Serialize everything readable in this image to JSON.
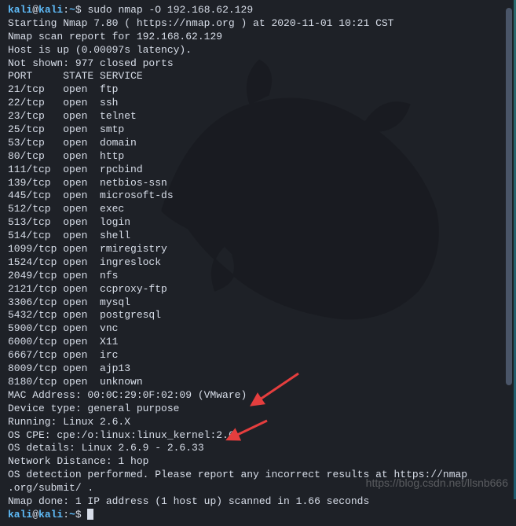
{
  "prompt1": {
    "user": "kali",
    "at": "@",
    "host": "kali",
    "colon": ":",
    "path": "~",
    "dollar": "$ ",
    "command": "sudo nmap -O 192.168.62.129"
  },
  "output": {
    "l01": "Starting Nmap 7.80 ( https://nmap.org ) at 2020-11-01 10:21 CST",
    "l02": "Nmap scan report for 192.168.62.129",
    "l03": "Host is up (0.00097s latency).",
    "l04": "Not shown: 977 closed ports",
    "l05": "PORT     STATE SERVICE",
    "l06": "21/tcp   open  ftp",
    "l07": "22/tcp   open  ssh",
    "l08": "23/tcp   open  telnet",
    "l09": "25/tcp   open  smtp",
    "l10": "53/tcp   open  domain",
    "l11": "80/tcp   open  http",
    "l12": "111/tcp  open  rpcbind",
    "l13": "139/tcp  open  netbios-ssn",
    "l14": "445/tcp  open  microsoft-ds",
    "l15": "512/tcp  open  exec",
    "l16": "513/tcp  open  login",
    "l17": "514/tcp  open  shell",
    "l18": "1099/tcp open  rmiregistry",
    "l19": "1524/tcp open  ingreslock",
    "l20": "2049/tcp open  nfs",
    "l21": "2121/tcp open  ccproxy-ftp",
    "l22": "3306/tcp open  mysql",
    "l23": "5432/tcp open  postgresql",
    "l24": "5900/tcp open  vnc",
    "l25": "6000/tcp open  X11",
    "l26": "6667/tcp open  irc",
    "l27": "8009/tcp open  ajp13",
    "l28": "8180/tcp open  unknown",
    "l29": "MAC Address: 00:0C:29:0F:02:09 (VMware)",
    "l30": "Device type: general purpose",
    "l31": "Running: Linux 2.6.X",
    "l32": "OS CPE: cpe:/o:linux:linux_kernel:2.6",
    "l33": "OS details: Linux 2.6.9 - 2.6.33",
    "l34": "Network Distance: 1 hop",
    "l35": "",
    "l36": "OS detection performed. Please report any incorrect results at https://nmap",
    "l37": ".org/submit/ .",
    "l38": "Nmap done: 1 IP address (1 host up) scanned in 1.66 seconds"
  },
  "prompt2": {
    "user": "kali",
    "at": "@",
    "host": "kali",
    "colon": ":",
    "path": "~",
    "dollar": "$ "
  },
  "watermark": "https://blog.csdn.net/llsnb666"
}
